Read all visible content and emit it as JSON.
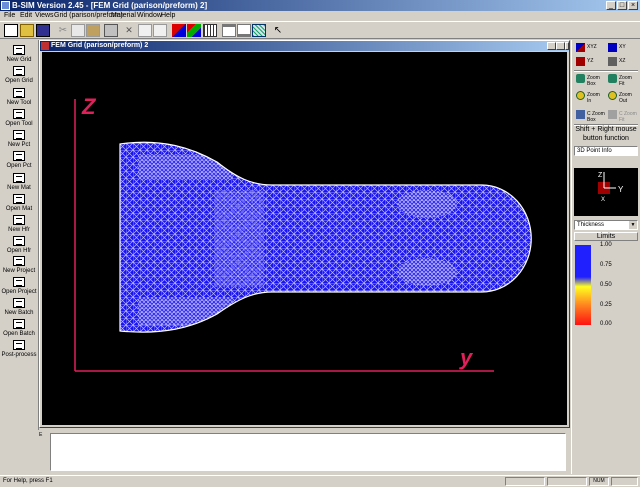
{
  "window": {
    "title": "B-SIM Version 2.45 - [FEM Grid (parison/preform) 2]"
  },
  "menu": [
    "File",
    "Edit",
    "Views",
    "Grid (parison/preform)",
    "Material",
    "Window",
    "Help"
  ],
  "toolbar": {
    "icons": [
      "new-file-icon",
      "open-folder-icon",
      "save-icon",
      "cut-icon",
      "copy-icon",
      "paste-icon",
      "print-icon",
      "xy-axes-icon",
      "mail-icon",
      "list-icon",
      "color-grid-icon",
      "color-grid-2-icon",
      "grid-icon",
      "window-icon",
      "window-2-icon",
      "mesh-icon",
      "help-pointer-icon"
    ]
  },
  "left_panel": {
    "buttons": [
      "New Grid",
      "Open Grid",
      "New Tool",
      "Open Tool",
      "New Pct",
      "Open Pct",
      "New Mat",
      "Open Mat",
      "New Hfr",
      "Open Hfr",
      "New Project",
      "Open Project",
      "New Batch",
      "Open Batch",
      "Post-process"
    ]
  },
  "mdi": {
    "title": "FEM Grid (parison/preform) 2",
    "axis_z": "Z",
    "axis_y": "y"
  },
  "right_panel": {
    "views": [
      {
        "label": "XYZ",
        "color": "#a00000"
      },
      {
        "label": "XY",
        "color": "#0000c0"
      },
      {
        "label": "YZ",
        "color": "#a00000"
      },
      {
        "label": "XZ",
        "color": "#606060"
      }
    ],
    "zoom": [
      {
        "label": "Zoom Box",
        "icon": "zoom-box-icon"
      },
      {
        "label": "Zoom Fit",
        "icon": "zoom-fit-icon"
      },
      {
        "label": "Zoom In",
        "icon": "zoom-in-icon"
      },
      {
        "label": "Zoom Out",
        "icon": "zoom-out-icon"
      },
      {
        "label": "C Zoom Box",
        "icon": "c-zoom-box-icon"
      },
      {
        "label": "C Zoom Fit",
        "icon": "c-zoom-fit-icon"
      }
    ],
    "hint_line1": "Shift + Right mouse",
    "hint_line2": "button function",
    "point_info": "3D Point Info",
    "mini_axis": {
      "z": "Z",
      "x": "X",
      "y": "Y"
    },
    "thickness_select": "Thickness",
    "limits_label": "Limits",
    "colorbar_values": [
      "1.00",
      "0.75",
      "0.50",
      "0.25",
      "0.00"
    ],
    "colors": {
      "high": "#2020ff",
      "mid": "#ffff20",
      "low": "#ff1010"
    }
  },
  "output": {
    "grip": "E"
  },
  "status": {
    "text": "For Help, press F1",
    "num": "NUM"
  }
}
